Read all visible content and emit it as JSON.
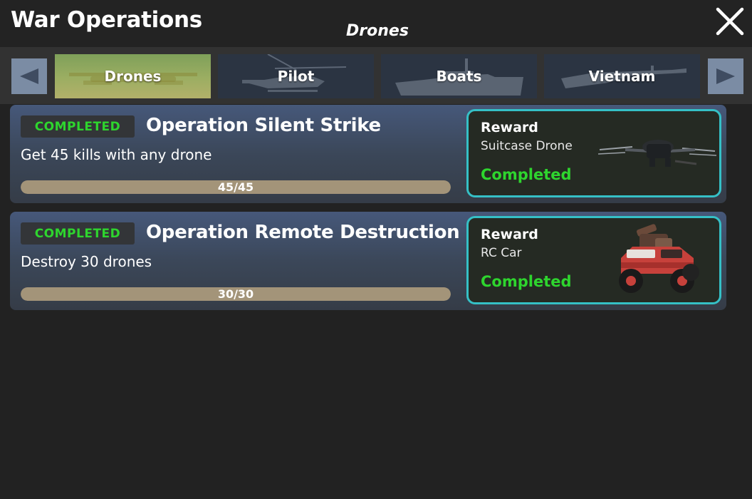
{
  "header": {
    "title": "War Operations",
    "subtitle": "Drones",
    "close_icon": "close-icon"
  },
  "tabs": [
    {
      "label": "Drones",
      "active": true
    },
    {
      "label": "Pilot",
      "active": false
    },
    {
      "label": "Boats",
      "active": false
    },
    {
      "label": "Vietnam",
      "active": false
    }
  ],
  "nav": {
    "prev_icon": "arrow-left-icon",
    "next_icon": "arrow-right-icon"
  },
  "operations": [
    {
      "status_badge": "COMPLETED",
      "name": "Operation Silent Strike",
      "description": "Get 45 kills with any drone",
      "progress_text": "45/45",
      "progress_fraction": 1.0,
      "reward": {
        "title": "Reward",
        "item": "Suitcase Drone",
        "status": "Completed",
        "image_icon": "suitcase-drone-icon"
      }
    },
    {
      "status_badge": "COMPLETED",
      "name": "Operation Remote Destruction",
      "description": "Destroy 30 drones",
      "progress_text": "30/30",
      "progress_fraction": 1.0,
      "reward": {
        "title": "Reward",
        "item": "RC Car",
        "status": "Completed",
        "image_icon": "rc-car-icon"
      }
    }
  ],
  "colors": {
    "completed_green": "#2ed52e",
    "reward_border": "#35c0c6",
    "progress_fill": "#a39479",
    "active_tab": "#9cae62"
  }
}
